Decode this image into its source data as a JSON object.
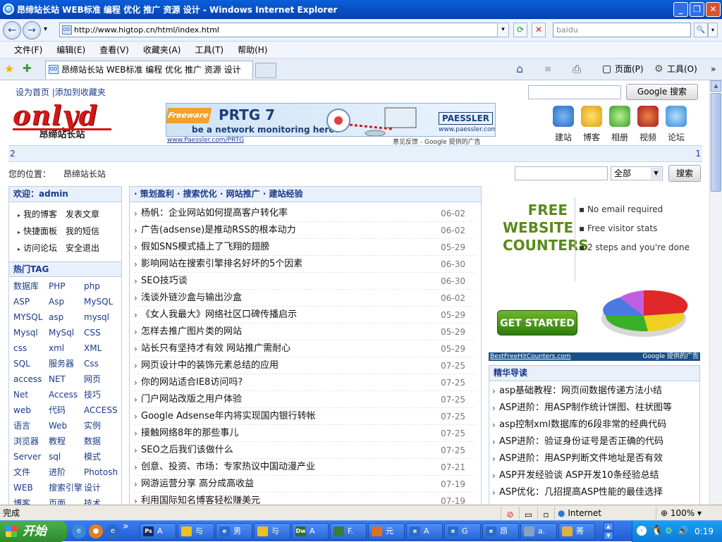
{
  "window": {
    "title": "昂缔站长站 WEB标准 编程 优化 推广 资源 设计 - Windows Internet Explorer",
    "minimize": "_",
    "maximize": "❐",
    "close": "✕"
  },
  "address_bar": {
    "page_icon": "OD",
    "url": "http://www.higtop.cn/html/index.html",
    "search_placeholder": "baidu",
    "back": "←",
    "forward": "→",
    "dropdown": "▾",
    "refresh": "⟳",
    "stop": "✕",
    "search_go": "🔍"
  },
  "menu": [
    "文件(F)",
    "编辑(E)",
    "查看(V)",
    "收藏夹(A)",
    "工具(T)",
    "帮助(H)"
  ],
  "tabbar": {
    "favorites_star": "★",
    "add_favorite": "✚",
    "tab_icon": "OD",
    "tab_title": "昂缔站长站 WEB标准 编程 优化 推广 资源 设计",
    "home": "⌂",
    "feeds": "≋",
    "print": "⎙",
    "page": "页面(P)",
    "tools": "工具(O)",
    "more": "»"
  },
  "page": {
    "top_links": "设为首页 |添加到收藏夹",
    "google_btn": "Google 搜索",
    "logo_text": "onlyd",
    "logo_sub": "昂缔站长站",
    "banner": {
      "badge": "Freeware",
      "title": "PRTG 7",
      "tagline": "be a network monitoring hero!",
      "brand": "PAESSLER",
      "brand_url": "www.paessler.com",
      "link": "www.Paessler.com/PRTG",
      "feedback": "意见反馈 - Google 提供的广告"
    },
    "categories": [
      "建站",
      "博客",
      "相册",
      "视频",
      "论坛"
    ],
    "bar2_left": "2",
    "bar2_right": "1",
    "location_label": "您的位置：",
    "location_value": "昂缔站长站",
    "search_select": "全部",
    "search_btn": "搜索",
    "welcome": "欢迎：admin",
    "user_links": [
      [
        "我的博客",
        "发表文章"
      ],
      [
        "快捷面板",
        "我的短信"
      ],
      [
        "访问论坛",
        "安全退出"
      ]
    ],
    "hot_tag_title": "热门TAG",
    "tags": [
      "数据库",
      "PHP",
      "php",
      "ASP",
      "Asp",
      "MySQL",
      "MYSQL",
      "asp",
      "mysql",
      "Mysql",
      "MySql",
      "CSS",
      "css",
      "xml",
      "XML",
      "SQL",
      "服务器",
      "Css",
      "access",
      "NET",
      "网页",
      "Net",
      "Access",
      "技巧",
      "web",
      "代码",
      "ACCESS",
      "语言",
      "Web",
      "实例",
      "浏览器",
      "教程",
      "数据",
      "Server",
      "sql",
      "模式",
      "文件",
      "进阶",
      "Photosh",
      "WEB",
      "搜索引擎",
      "设计",
      "博客",
      "页面",
      "技术"
    ],
    "mid_header": "· 策划盈利 · 搜索优化 · 网站推广 · 建站经验",
    "articles": [
      {
        "t": "杨帆：企业网站如何提高客户转化率",
        "d": "06-02"
      },
      {
        "t": "广告(adsense)是推动RSS的根本动力",
        "d": "06-02"
      },
      {
        "t": "假如SNS模式插上了飞翔的翅膀",
        "d": "05-29"
      },
      {
        "t": "影响网站在搜索引擎排名好坏的5个因素",
        "d": "06-30"
      },
      {
        "t": "SEO技巧谈",
        "d": "06-30"
      },
      {
        "t": "浅谈外链沙盒与输出沙盒",
        "d": "06-02"
      },
      {
        "t": "《女人我最大》网络社区口碑传播启示",
        "d": "05-29"
      },
      {
        "t": "怎样去推广图片类的网站",
        "d": "05-29"
      },
      {
        "t": "站长只有坚持才有效 网站推广需耐心",
        "d": "05-29"
      },
      {
        "t": "网页设计中的装饰元素总结的应用",
        "d": "07-25"
      },
      {
        "t": "你的网站适合IE8访问吗?",
        "d": "07-25"
      },
      {
        "t": "门户网站改版之用户体验",
        "d": "07-25"
      },
      {
        "t": "Google Adsense年内将实现国内银行转帐",
        "d": "07-25"
      },
      {
        "t": "接触网络8年的那些事儿",
        "d": "07-25"
      },
      {
        "t": "SEO之后我们该做什么",
        "d": "07-25"
      },
      {
        "t": "创意、投资、市场：专家热议中国动漫产业",
        "d": "07-21"
      },
      {
        "t": "网游运营分享 高分成高收益",
        "d": "07-19"
      },
      {
        "t": "利用国际知名博客轻松赚美元",
        "d": "07-19"
      }
    ],
    "ad2": {
      "free": [
        "FREE",
        "WEBSITE",
        "COUNTERS"
      ],
      "bullets": [
        "No email required",
        "Free visitor stats",
        "2 steps and you're done"
      ],
      "cta": "GET STARTED",
      "foot_link": "BestFreeHitCounters.com",
      "foot_right": "Google 提供的广告"
    },
    "featured_title": "精华导读",
    "featured": [
      "asp基础教程：网页间数据传递方法小结",
      "ASP进阶：用ASP制作统计饼图、柱状图等",
      "asp控制xml数据库的6段非常的经典代码",
      "ASP进阶：验证身份证号是否正确的代码",
      "ASP进阶：用ASP判断文件地址是否有效",
      "ASP开发经验谈 ASP开发10条经验总结",
      "ASP优化：几招提高ASP性能的最佳选择"
    ]
  },
  "status": {
    "text": "完成",
    "zone": "Internet",
    "zoom": "100%"
  },
  "taskbar": {
    "start": "开始",
    "more": "»",
    "tasks": [
      {
        "icon": "Ps",
        "label": "A"
      },
      {
        "icon": "",
        "label": "与"
      },
      {
        "icon": "e",
        "label": "男"
      },
      {
        "icon": "",
        "label": "与"
      },
      {
        "icon": "Dw",
        "label": "A"
      },
      {
        "icon": "",
        "label": "F."
      },
      {
        "icon": "",
        "label": "元"
      },
      {
        "icon": "e",
        "label": "A"
      },
      {
        "icon": "e",
        "label": "G"
      },
      {
        "icon": "e",
        "label": "昂"
      },
      {
        "icon": "",
        "label": "a."
      },
      {
        "icon": "",
        "label": "莠"
      }
    ],
    "clock": "0:19"
  },
  "colors": {
    "titlebar": "#0a5fd8",
    "accent_blue": "#1a3a8a",
    "logo_red": "#d01818",
    "panel_head": "#e8f0fb",
    "taskbar": "#225ad2",
    "start_green": "#3a9a3a"
  }
}
